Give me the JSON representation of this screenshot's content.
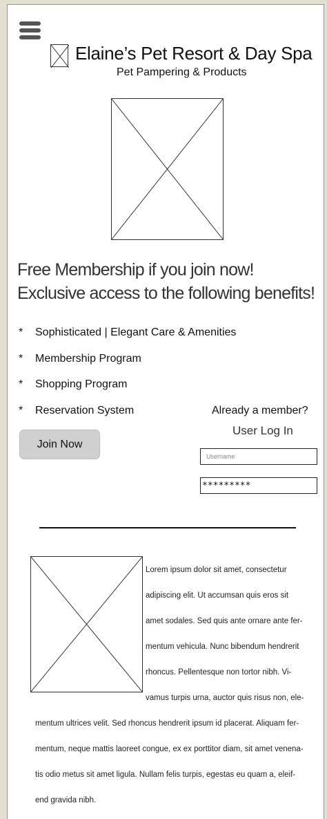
{
  "header": {
    "menu_icon": "hamburger-icon",
    "logo_icon": "image-placeholder-icon",
    "title": "Elaine’s Pet Resort & Day Spa",
    "tagline": "Pet Pampering & Products"
  },
  "promo": {
    "headline_line1": "Free Membership if you join now!",
    "headline_line2": "Exclusive access to the following benefits!",
    "bullet": "*",
    "benefits": [
      "Sophisticated | Elegant Care & Amenities",
      "Membership Program",
      "Shopping Program",
      "Reservation System"
    ],
    "join_label": "Join Now"
  },
  "login": {
    "member_prompt": "Already a member?",
    "title": "User Log In",
    "username_placeholder": "Username",
    "password_value": "*********"
  },
  "article": {
    "lines": [
      "Lorem ipsum dolor sit amet, consectetur",
      "adipiscing elit. Ut accumsan quis eros sit",
      "amet sodales. Sed quis ante ornare ante fer-",
      "mentum vehicula. Nunc bibendum hendrerit",
      "rhoncus. Pellentesque non tortor nibh. Vi-",
      "vamus turpis urna, auctor quis risus non, ele-"
    ],
    "lines_full": [
      "mentum ultrices velit. Sed rhoncus hendrerit ipsum id placerat. Aliquam fer-",
      "mentum, neque mattis laoreet congue, ex ex porttitor diam, sit amet venena-",
      "tis odio metus sit amet ligula. Nullam felis turpis, egestas eu quam a, eleif-",
      "end gravida nibh."
    ]
  },
  "colors": {
    "page_background": "#e3dfd1",
    "button_background": "#d0d0d0"
  }
}
